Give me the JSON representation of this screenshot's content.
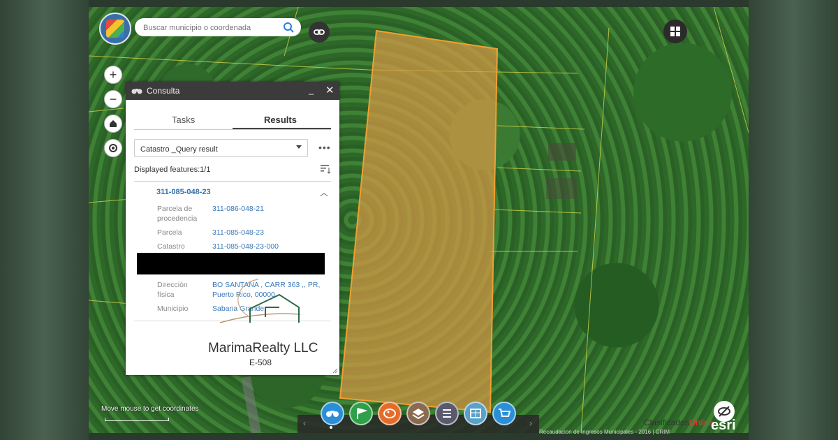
{
  "search": {
    "placeholder": "Buscar municipio o coordenada"
  },
  "panel": {
    "title": "Consulta",
    "tabs": [
      "Tasks",
      "Results"
    ],
    "active_tab": "Results",
    "query_select": "Catastro _Query result",
    "displayed_features": "Displayed features:1/1",
    "parcel_id": "311-085-048-23",
    "fields": [
      {
        "label": "Parcela de procedencia",
        "value": "311-086-048-21"
      },
      {
        "label": "Parcela",
        "value": "311-085-048-23"
      },
      {
        "label": "Catastro",
        "value": "311-085-048-23-000"
      },
      {
        "label": "Dirección física",
        "value": "BO SANTANA , CARR 363 ,, PR, Puerto Rico, 00000"
      },
      {
        "label": "Municipio",
        "value": "Sabana Grande"
      }
    ]
  },
  "watermark": {
    "company": "MarimaRealty LLC",
    "license": "E-508"
  },
  "bottom": {
    "coords_hint": "Move mouse to get coordinates",
    "credits": "Recaudacion de Ingresos Municipales - 2016 | CRIM",
    "clasificados_a": "Clasificados",
    "clasificados_b": "Online",
    "esri": "esri"
  },
  "dock_icons": [
    "binoculars-icon",
    "flag-icon",
    "palette-icon",
    "layers-icon",
    "list-icon",
    "table-icon",
    "cart-icon"
  ],
  "colors": {
    "parcel_fill": "#d79a45",
    "parcel_stroke": "#f0a030",
    "link_blue": "#3a79b8",
    "dock": [
      "#2b8fd8",
      "#2ea04a",
      "#e46c2a",
      "#8a6b4f",
      "#5a5a6e",
      "#5aa0c8",
      "#2b8fd8"
    ]
  }
}
